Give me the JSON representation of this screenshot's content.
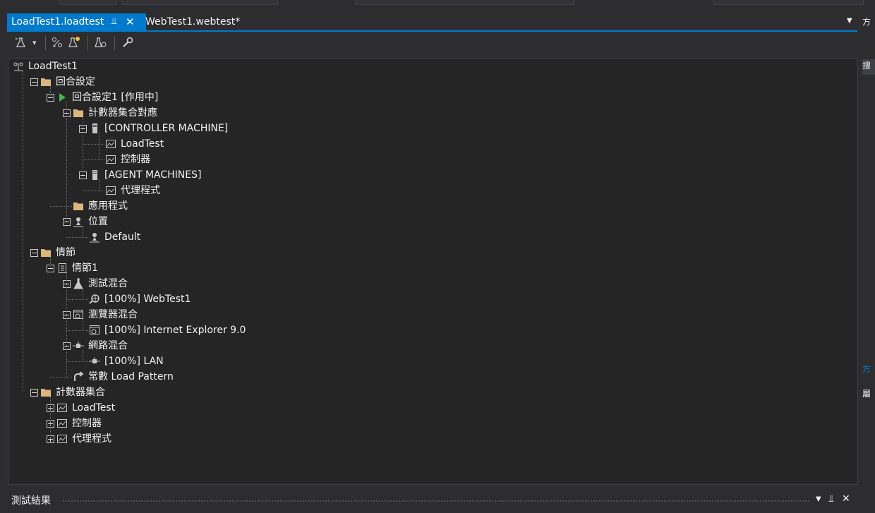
{
  "tabs": [
    {
      "label": "LoadTest1.loadtest",
      "active": true
    },
    {
      "label": "WebTest1.webtest*",
      "active": false
    }
  ],
  "tab_icons": {
    "pin": "⫫",
    "close": "✕",
    "dropdown": "▼"
  },
  "toolbar": {
    "items": [
      {
        "name": "run-test-icon",
        "glyph": "⚗"
      },
      {
        "name": "dropdown-arrow-icon",
        "glyph": "▾"
      },
      {
        "name": "add-scenario-icon",
        "glyph": "⚒"
      },
      {
        "name": "add-counter-set-icon",
        "glyph": "✴"
      },
      {
        "name": "manage-rigs-icon",
        "glyph": "⚖"
      },
      {
        "name": "wrench-icon",
        "glyph": "⚒"
      }
    ]
  },
  "tree": [
    {
      "id": "root",
      "depth": 0,
      "label": "LoadTest1",
      "icon": "loadtest",
      "expander": "none"
    },
    {
      "id": "run-settings",
      "depth": 1,
      "label": "回合設定",
      "icon": "folder",
      "expander": "minus"
    },
    {
      "id": "run-settings-1",
      "depth": 2,
      "label": "回合設定1 [作用中]",
      "icon": "play",
      "expander": "minus"
    },
    {
      "id": "counter-set-map",
      "depth": 3,
      "label": "計數器集合對應",
      "icon": "folder",
      "expander": "minus"
    },
    {
      "id": "controller-machine",
      "depth": 4,
      "label": "[CONTROLLER MACHINE]",
      "icon": "machine",
      "expander": "minus"
    },
    {
      "id": "cm-loadtest",
      "depth": 5,
      "label": "LoadTest",
      "icon": "counter",
      "expander": "none"
    },
    {
      "id": "cm-controller",
      "depth": 5,
      "label": "控制器",
      "icon": "counter",
      "expander": "none"
    },
    {
      "id": "agent-machines",
      "depth": 4,
      "label": "[AGENT MACHINES]",
      "icon": "machine",
      "expander": "minus"
    },
    {
      "id": "am-agent",
      "depth": 5,
      "label": "代理程式",
      "icon": "counter",
      "expander": "none"
    },
    {
      "id": "applications",
      "depth": 3,
      "label": "應用程式",
      "icon": "folder",
      "expander": "none"
    },
    {
      "id": "locations",
      "depth": 3,
      "label": "位置",
      "icon": "location",
      "expander": "minus"
    },
    {
      "id": "location-default",
      "depth": 4,
      "label": "Default",
      "icon": "location",
      "expander": "none"
    },
    {
      "id": "scenarios",
      "depth": 1,
      "label": "情節",
      "icon": "folder",
      "expander": "minus"
    },
    {
      "id": "scenario-1",
      "depth": 2,
      "label": "情節1",
      "icon": "scenario",
      "expander": "minus"
    },
    {
      "id": "test-mix",
      "depth": 3,
      "label": "測試混合",
      "icon": "flask",
      "expander": "minus"
    },
    {
      "id": "test-mix-webtest1",
      "depth": 4,
      "label": "[100%] WebTest1",
      "icon": "webtest",
      "expander": "none"
    },
    {
      "id": "browser-mix",
      "depth": 3,
      "label": "瀏覽器混合",
      "icon": "browser",
      "expander": "minus"
    },
    {
      "id": "browser-ie9",
      "depth": 4,
      "label": "[100%] Internet Explorer 9.0",
      "icon": "browser",
      "expander": "none"
    },
    {
      "id": "network-mix",
      "depth": 3,
      "label": "網路混合",
      "icon": "network",
      "expander": "minus"
    },
    {
      "id": "network-lan",
      "depth": 4,
      "label": "[100%] LAN",
      "icon": "network",
      "expander": "none"
    },
    {
      "id": "load-pattern",
      "depth": 3,
      "label": "常數 Load Pattern",
      "icon": "pattern",
      "expander": "none"
    },
    {
      "id": "counter-sets",
      "depth": 1,
      "label": "計數器集合",
      "icon": "folder",
      "expander": "minus"
    },
    {
      "id": "cs-loadtest",
      "depth": 2,
      "label": "LoadTest",
      "icon": "counter",
      "expander": "plus"
    },
    {
      "id": "cs-controller",
      "depth": 2,
      "label": "控制器",
      "icon": "counter",
      "expander": "plus"
    },
    {
      "id": "cs-agent",
      "depth": 2,
      "label": "代理程式",
      "icon": "counter",
      "expander": "plus"
    }
  ],
  "bottom_panel": {
    "title": "測試結果",
    "dropdown": "▼",
    "pin": "⫫",
    "close": "✕"
  },
  "right_panel": {
    "items": [
      "方",
      "搜",
      "方",
      "屬"
    ]
  },
  "colors": {
    "accent": "#007acc",
    "folder": "#dcb67a",
    "play": "#3fb950"
  }
}
